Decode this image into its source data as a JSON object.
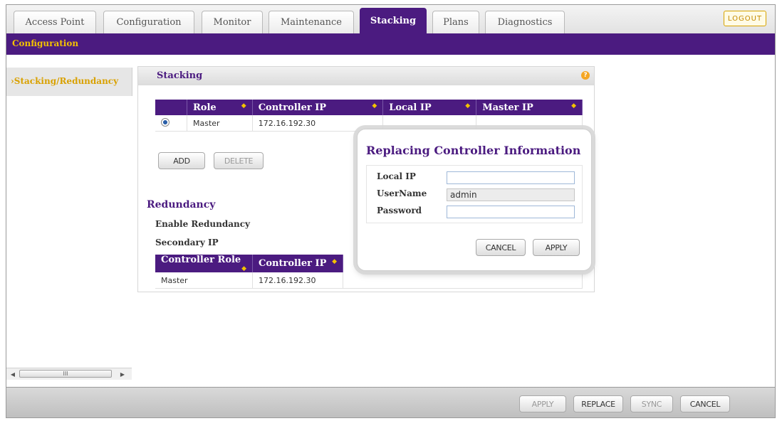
{
  "tabs": [
    {
      "label": "Access Point",
      "active": false
    },
    {
      "label": "Configuration",
      "active": false
    },
    {
      "label": "Monitor",
      "active": false
    },
    {
      "label": "Maintenance",
      "active": false
    },
    {
      "label": "Stacking",
      "active": true
    },
    {
      "label": "Plans",
      "active": false
    },
    {
      "label": "Diagnostics",
      "active": false
    }
  ],
  "logout_label": "LOGOUT",
  "subnav": {
    "label": "Configuration"
  },
  "leftnav": {
    "item": "›Stacking/Redundancy"
  },
  "stacking": {
    "title": "Stacking",
    "help_icon": "help-icon",
    "columns": [
      "Role",
      "Controller IP",
      "Local IP",
      "Master IP"
    ],
    "rows": [
      {
        "role": "Master",
        "controller_ip": "172.16.192.30",
        "local_ip": "",
        "master_ip": ""
      }
    ],
    "add_label": "ADD",
    "delete_label": "DELETE"
  },
  "redundancy": {
    "title": "Redundancy",
    "enable_label": "Enable Redundancy",
    "secondary_label": "Secondary IP",
    "columns": [
      "Controller Role",
      "Controller IP"
    ],
    "rows": [
      {
        "role": "Master",
        "controller_ip": "172.16.192.30"
      }
    ]
  },
  "modal": {
    "title": "Replacing Controller Information",
    "local_ip_label": "Local IP",
    "local_ip_value": "",
    "username_label": "UserName",
    "username_value": "admin",
    "password_label": "Password",
    "password_value": "",
    "cancel_label": "CANCEL",
    "apply_label": "APPLY"
  },
  "scrollbar": {
    "thumb_glyph": "III"
  },
  "bottom": {
    "apply_label": "APPLY",
    "replace_label": "REPLACE",
    "sync_label": "SYNC",
    "cancel_label": "CANCEL"
  },
  "colors": {
    "brand_purple": "#4b1b80",
    "accent_gold": "#f3c200"
  }
}
